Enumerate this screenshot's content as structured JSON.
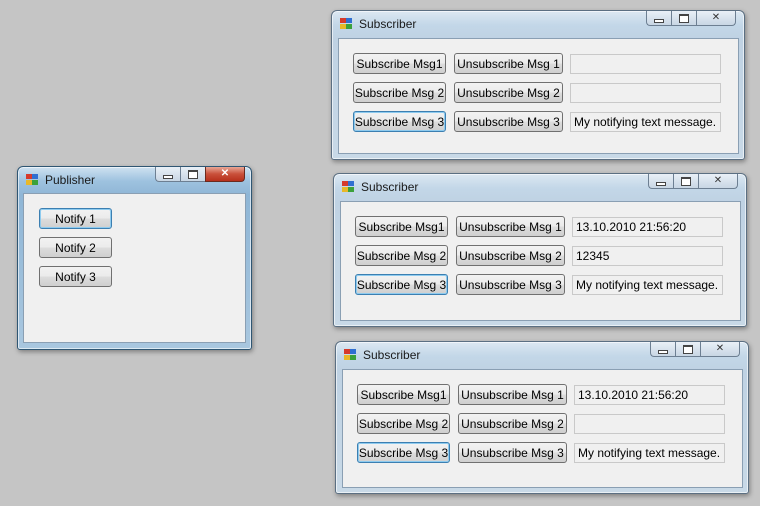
{
  "publisher": {
    "title": "Publisher",
    "buttons": [
      "Notify 1",
      "Notify 2",
      "Notify 3"
    ]
  },
  "subscribers": [
    {
      "title": "Subscriber",
      "rows": [
        {
          "subscribe": "Subscribe Msg1",
          "unsubscribe": "Unsubscribe Msg 1",
          "value": ""
        },
        {
          "subscribe": "Subscribe Msg 2",
          "unsubscribe": "Unsubscribe Msg 2",
          "value": ""
        },
        {
          "subscribe": "Subscribe Msg 3",
          "unsubscribe": "Unsubscribe Msg 3",
          "value": "My notifying text message."
        }
      ]
    },
    {
      "title": "Subscriber",
      "rows": [
        {
          "subscribe": "Subscribe Msg1",
          "unsubscribe": "Unsubscribe Msg 1",
          "value": "13.10.2010 21:56:20"
        },
        {
          "subscribe": "Subscribe Msg 2",
          "unsubscribe": "Unsubscribe Msg 2",
          "value": "12345"
        },
        {
          "subscribe": "Subscribe Msg 3",
          "unsubscribe": "Unsubscribe Msg 3",
          "value": "My notifying text message."
        }
      ]
    },
    {
      "title": "Subscriber",
      "rows": [
        {
          "subscribe": "Subscribe Msg1",
          "unsubscribe": "Unsubscribe Msg 1",
          "value": "13.10.2010 21:56:20"
        },
        {
          "subscribe": "Subscribe Msg 2",
          "unsubscribe": "Unsubscribe Msg 2",
          "value": ""
        },
        {
          "subscribe": "Subscribe Msg 3",
          "unsubscribe": "Unsubscribe Msg 3",
          "value": "My notifying text message."
        }
      ]
    }
  ],
  "icons": {
    "app": "windows-forms-app-icon",
    "minimize": "minimize-icon",
    "maximize": "maximize-icon",
    "close": "close-icon"
  }
}
